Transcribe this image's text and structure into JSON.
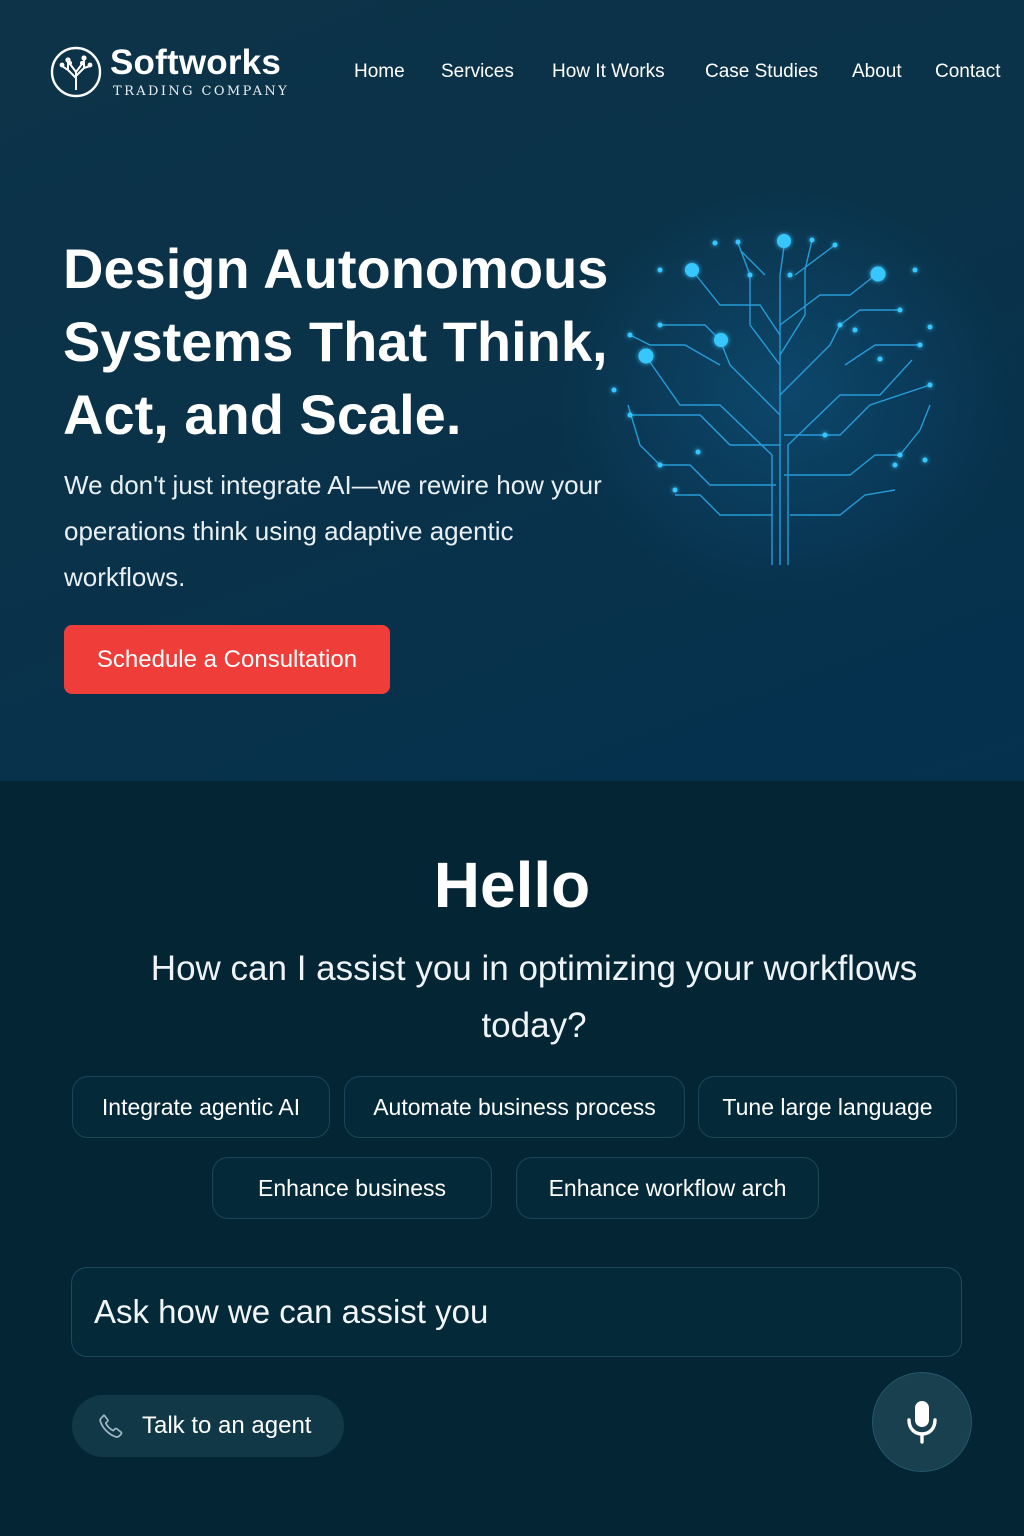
{
  "header": {
    "brand_name": "Softworks",
    "brand_tagline": "TRADING COMPANY",
    "logo_icon": "circuit-tree-icon",
    "nav": [
      {
        "label": "Home"
      },
      {
        "label": "Services"
      },
      {
        "label": "How It Works"
      },
      {
        "label": "Case Studies"
      },
      {
        "label": "About"
      },
      {
        "label": "Contact"
      }
    ]
  },
  "hero": {
    "title_lines": [
      "Design Autonomous",
      "Systems That Think,",
      "Act, and Scale."
    ],
    "subtitle": "We don't just integrate AI—we rewire how your operations think using adaptive agentic workflows.",
    "cta_label": "Schedule a Consultation",
    "illustration_icon": "neural-circuit-tree-icon"
  },
  "assistant": {
    "greeting": "Hello",
    "question": "How can I assist you in optimizing your workflows today?",
    "suggestions": [
      {
        "label": "Integrate agentic AI"
      },
      {
        "label": "Automate business process"
      },
      {
        "label": "Tune large language"
      },
      {
        "label": "Enhance business"
      },
      {
        "label": "Enhance workflow arch"
      }
    ],
    "input_placeholder": "Ask how we can assist you",
    "agent_button_label": "Talk to an agent",
    "agent_icon": "phone-icon",
    "mic_icon": "microphone-icon"
  },
  "colors": {
    "accent_cta": "#ef3d3a",
    "hero_bg": "#0b3349",
    "lower_bg": "#032534",
    "glow": "#2fb7ff"
  }
}
